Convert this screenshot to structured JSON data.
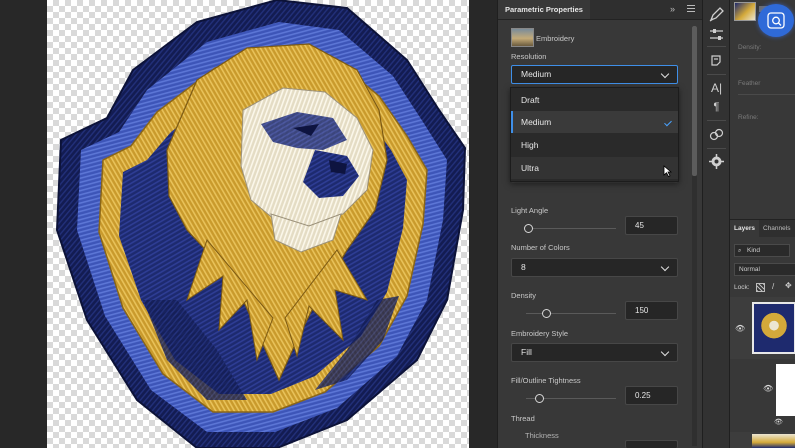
{
  "canvas": {
    "artwork": "embroidered lion mascot crest"
  },
  "properties_panel": {
    "tab_title": "Parametric Properties",
    "layer_type": "Embroidery",
    "resolution": {
      "label": "Resolution",
      "value": "Medium",
      "options": [
        "Draft",
        "Medium",
        "High",
        "Ultra"
      ],
      "selected": "Medium"
    },
    "light_angle": {
      "label": "Light Angle",
      "value": "45"
    },
    "number_of_colors": {
      "label": "Number of Colors",
      "value": "8"
    },
    "density": {
      "label": "Density",
      "value": "150"
    },
    "embroidery_style": {
      "label": "Embroidery Style",
      "value": "Fill"
    },
    "fill_outline_tightness": {
      "label": "Fill/Outline Tightness",
      "value": "0.25"
    },
    "thread": {
      "label": "Thread",
      "thickness_label": "Thickness"
    }
  },
  "right_panel": {
    "density_label": "Density:",
    "feather_label": "Feather",
    "refine_label": "Refine:",
    "tabs": [
      "Layers",
      "Channels"
    ],
    "kind_filter": "Kind",
    "blend_mode": "Normal",
    "lock_label": "Lock:"
  },
  "icons": [
    "collapse-icon",
    "panel-menu-icon",
    "brush-tool-icon",
    "adjustments-icon",
    "history-icon",
    "character-icon",
    "paragraph-icon",
    "paths-icon",
    "contextual-settings-icon",
    "visual-search-icon"
  ],
  "colors": {
    "accent": "#3f8fe8",
    "panel_bg": "#383838",
    "canvas_bg": "#282828",
    "navy_thread": "#1e2a6e",
    "gold_thread": "#d4a93a",
    "cream_thread": "#ece6d2"
  }
}
